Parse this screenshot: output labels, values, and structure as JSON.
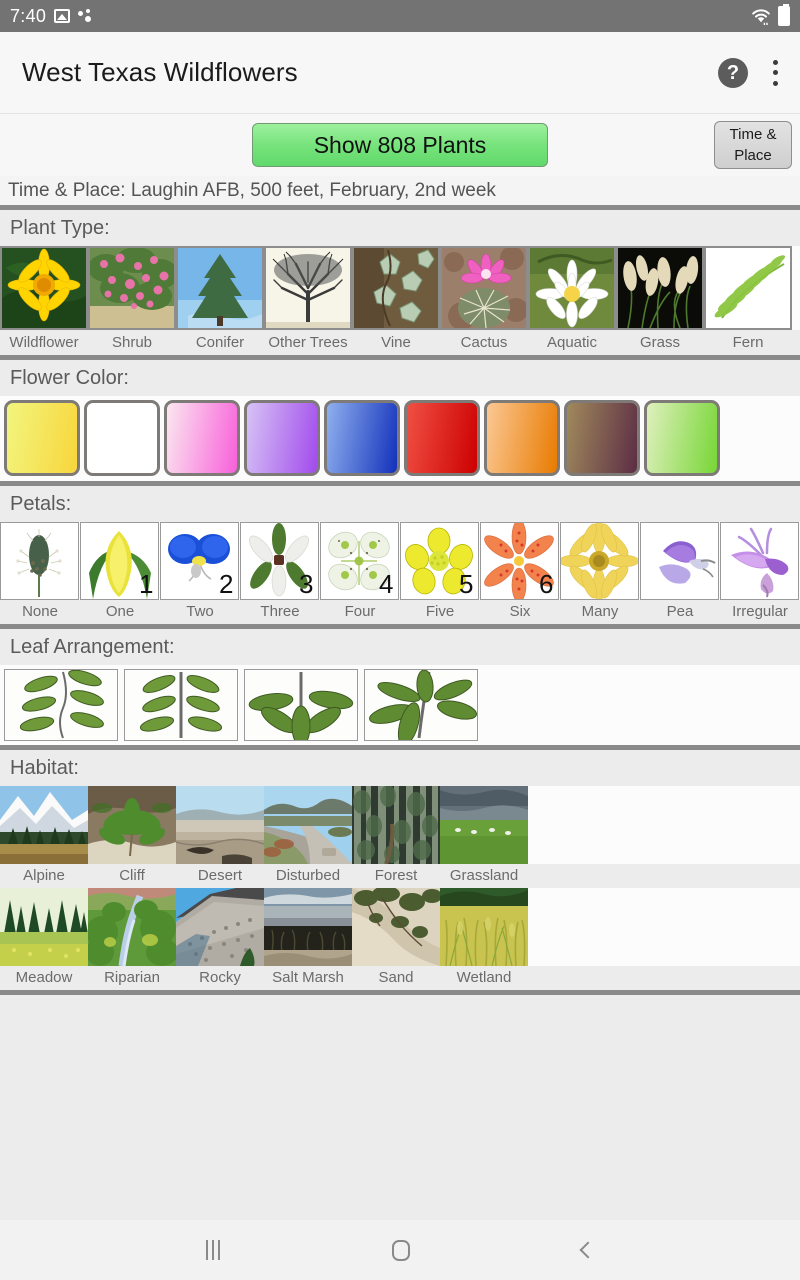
{
  "status_bar": {
    "time": "7:40",
    "icons_left": [
      "image-icon",
      "bluetooth-dots-icon"
    ],
    "icons_right": [
      "wifi-icon",
      "battery-icon"
    ]
  },
  "app_bar": {
    "title": "West Texas Wildflowers",
    "help_glyph": "?",
    "actions": [
      "help-icon",
      "overflow-menu-icon"
    ]
  },
  "action_row": {
    "show_button_label": "Show 808 Plants",
    "plant_count": 808,
    "time_place_button_line1": "Time &",
    "time_place_button_line2": "Place",
    "show_button_color": "#74e27a"
  },
  "time_place": {
    "text": "Time & Place: Laughin AFB, 500 feet, February, 2nd week",
    "location": "Laughin AFB",
    "elevation": "500 feet",
    "month": "February",
    "week": "2nd week"
  },
  "sections": {
    "plant_type": {
      "title": "Plant Type:",
      "items": [
        {
          "label": "Wildflower",
          "icon": "yellow-daisy-thumb"
        },
        {
          "label": "Shrub",
          "icon": "pink-shrub-thumb"
        },
        {
          "label": "Conifer",
          "icon": "conifer-tree-thumb"
        },
        {
          "label": "Other Trees",
          "icon": "bare-tree-thumb"
        },
        {
          "label": "Vine",
          "icon": "ivy-vine-thumb"
        },
        {
          "label": "Cactus",
          "icon": "pink-cactus-flower-thumb"
        },
        {
          "label": "Aquatic",
          "icon": "water-lily-thumb"
        },
        {
          "label": "Grass",
          "icon": "grass-seedhead-thumb"
        },
        {
          "label": "Fern",
          "icon": "fern-frond-thumb"
        }
      ]
    },
    "flower_color": {
      "title": "Flower Color:",
      "items": [
        {
          "name": "yellow",
          "from": "#f2f57e",
          "to": "#f8d63c"
        },
        {
          "name": "white",
          "from": "#ffffff",
          "to": "#ffffff"
        },
        {
          "name": "pink",
          "from": "#fbe7ef",
          "to": "#f860da"
        },
        {
          "name": "purple",
          "from": "#d6c3f5",
          "to": "#a24bec"
        },
        {
          "name": "blue",
          "from": "#8fb0ee",
          "to": "#1331bb"
        },
        {
          "name": "red",
          "from": "#f05044",
          "to": "#cc0000"
        },
        {
          "name": "orange",
          "from": "#fbc894",
          "to": "#e87b00"
        },
        {
          "name": "brown",
          "from": "#a08a5c",
          "to": "#5c2d45"
        },
        {
          "name": "green",
          "from": "#dff0bd",
          "to": "#77d636"
        }
      ]
    },
    "petals": {
      "title": "Petals:",
      "items": [
        {
          "label": "None",
          "number": "",
          "icon": "plantain-spike-thumb"
        },
        {
          "label": "One",
          "number": "1",
          "icon": "one-petal-thumb"
        },
        {
          "label": "Two",
          "number": "2",
          "icon": "two-petal-blue-thumb"
        },
        {
          "label": "Three",
          "number": "3",
          "icon": "trillium-thumb"
        },
        {
          "label": "Four",
          "number": "4",
          "icon": "four-petal-thumb"
        },
        {
          "label": "Five",
          "number": "5",
          "icon": "five-petal-yellow-thumb"
        },
        {
          "label": "Six",
          "number": "6",
          "icon": "six-petal-orange-thumb"
        },
        {
          "label": "Many",
          "number": "",
          "icon": "many-petal-yellow-thumb"
        },
        {
          "label": "Pea",
          "number": "",
          "icon": "pea-flower-thumb"
        },
        {
          "label": "Irregular",
          "number": "",
          "icon": "irregular-flower-thumb"
        }
      ]
    },
    "leaf_arrangement": {
      "title": "Leaf Arrangement:",
      "items": [
        {
          "name": "alternate-leaves"
        },
        {
          "name": "opposite-leaves"
        },
        {
          "name": "whorled-leaves"
        },
        {
          "name": "palmate-leaves"
        }
      ]
    },
    "habitat": {
      "title": "Habitat:",
      "items": [
        {
          "label": "Alpine",
          "icon": "alpine-mountain-thumb"
        },
        {
          "label": "Cliff",
          "icon": "cliff-fern-thumb"
        },
        {
          "label": "Desert",
          "icon": "desert-flat-thumb"
        },
        {
          "label": "Disturbed",
          "icon": "roadside-thumb"
        },
        {
          "label": "Forest",
          "icon": "forest-trees-thumb"
        },
        {
          "label": "Grassland",
          "icon": "grassland-field-thumb"
        },
        {
          "label": "Meadow",
          "icon": "meadow-thumb"
        },
        {
          "label": "Riparian",
          "icon": "stream-riparian-thumb"
        },
        {
          "label": "Rocky",
          "icon": "rocky-scree-thumb"
        },
        {
          "label": "Salt Marsh",
          "icon": "salt-marsh-thumb"
        },
        {
          "label": "Sand",
          "icon": "sand-dune-thumb"
        },
        {
          "label": "Wetland",
          "icon": "wetland-reeds-thumb"
        }
      ]
    }
  },
  "nav_bar": {
    "items": [
      "recents-icon",
      "home-icon",
      "back-icon"
    ]
  }
}
